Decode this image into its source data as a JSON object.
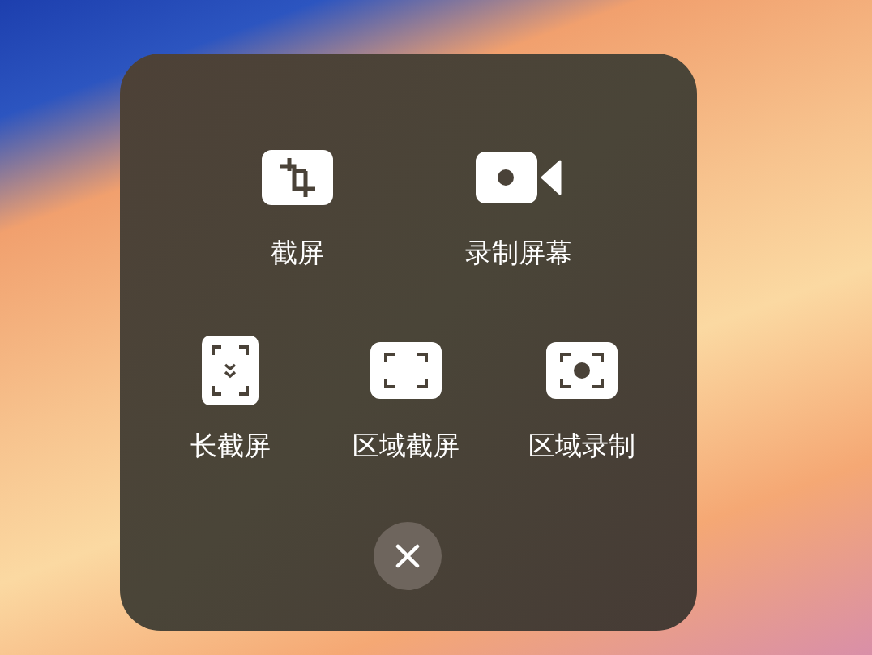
{
  "top_row": [
    {
      "kind": "crop",
      "label": "截屏"
    },
    {
      "kind": "record",
      "label": "录制屏幕"
    }
  ],
  "bottom_row": [
    {
      "kind": "long",
      "label": "长截屏"
    },
    {
      "kind": "region",
      "label": "区域截屏"
    },
    {
      "kind": "region_record",
      "label": "区域录制"
    }
  ]
}
